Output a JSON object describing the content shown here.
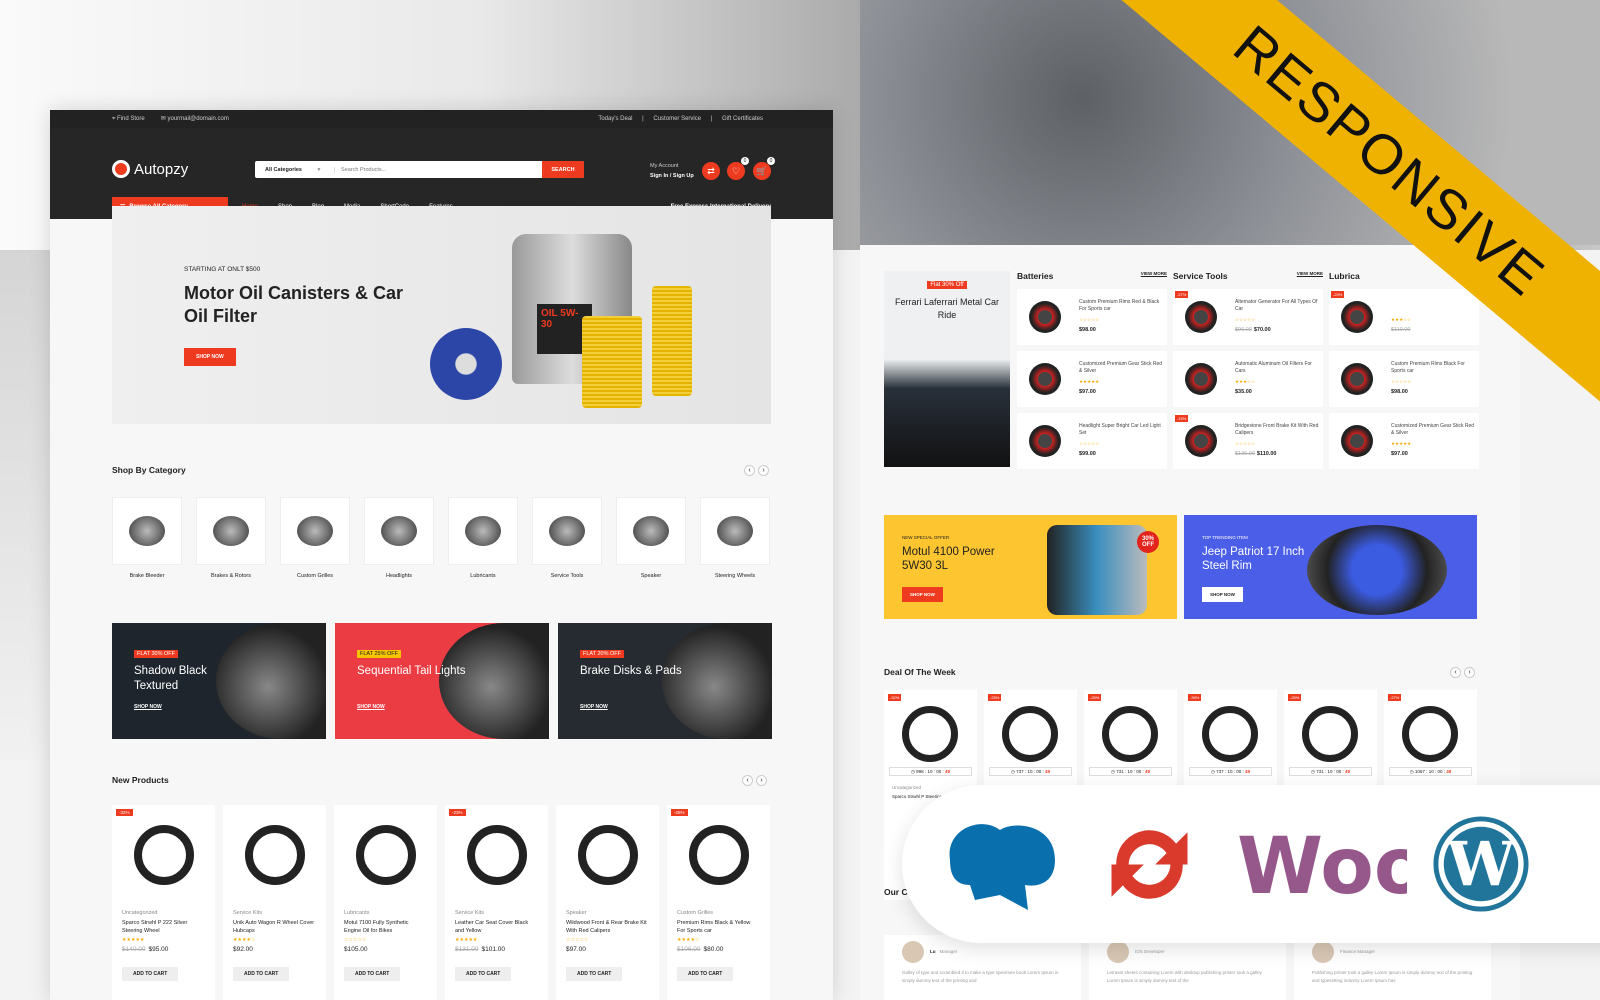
{
  "topbar": {
    "find_store": "Find Store",
    "email": "yourmail@domain.com",
    "links": [
      "Today's Deal",
      "Customer Service",
      "Gift Certificates"
    ]
  },
  "header": {
    "brand": "Autopzy",
    "category": "All Categories",
    "search_placeholder": "Search Products...",
    "search_button": "SEARCH",
    "account_label": "My Account",
    "sign_in": "Sign In / Sign Up",
    "wishlist_count": "0",
    "cart_count": "0"
  },
  "nav": {
    "browse": "Browse All Category",
    "items": [
      "Home",
      "Shop",
      "Blog",
      "Media",
      "ShortCode",
      "Features"
    ],
    "delivery": "Free Express International Delivery"
  },
  "hero": {
    "subtitle": "STARTING AT ONLT $500",
    "title": "Motor Oil Canisters & Car Oil Filter",
    "button": "SHOP NOW",
    "product_label": "OIL 5W-30"
  },
  "shop_by_category": {
    "title": "Shop By Category",
    "items": [
      "Brake Bleeder",
      "Brakes & Rotors",
      "Custom Grilles",
      "Headlights",
      "Lubricants",
      "Service Tools",
      "Speaker",
      "Steering Wheels"
    ]
  },
  "promos": [
    {
      "tag": "FLAT 30% OFF",
      "title": "Shadow Black Textured",
      "link": "SHOP NOW",
      "bg": "#1e252d",
      "tag_bg": "#ee3b1f"
    },
    {
      "tag": "FLAT 25% OFF",
      "title": "Sequential Tail Lights",
      "link": "SHOP NOW",
      "bg": "#ec3c43",
      "tag_bg": "#f5c400"
    },
    {
      "tag": "FLAT 20% OFF",
      "title": "Brake Disks & Pads",
      "link": "SHOP NOW",
      "bg": "#262b31",
      "tag_bg": "#ee3b1f"
    }
  ],
  "new_products": {
    "title": "New Products",
    "add_label": "ADD TO CART",
    "items": [
      {
        "badge": "-32%",
        "category": "Uncategorized",
        "name": "Sparco Strwhl P 222 Silver Steering Wheel",
        "rating": 5,
        "old": "$140.00",
        "price": "$95.00"
      },
      {
        "badge": "",
        "category": "Service Kits",
        "name": "Unik Auto Wagon R Wheel Cover Hubcaps",
        "rating": 4,
        "old": "",
        "price": "$92.00"
      },
      {
        "badge": "",
        "category": "Lubricants",
        "name": "Motul 7100 Fully Synthetic Engine Oil for Bikes",
        "rating": 0,
        "old": "",
        "price": "$105.00"
      },
      {
        "badge": "-23%",
        "category": "Service Kits",
        "name": "Leather Car Seat Cover Black and Yellow",
        "rating": 5,
        "old": "$131.00",
        "price": "$101.00"
      },
      {
        "badge": "",
        "category": "Speaker",
        "name": "Wildwood Front & Rear Brake Kit With Red Calipers",
        "rating": 0,
        "old": "",
        "price": "$97.00"
      },
      {
        "badge": "-25%",
        "category": "Custom Grilles",
        "name": "Premium Rims Black & Yellow For Sports car",
        "rating": 4,
        "old": "$106.00",
        "price": "$80.00"
      }
    ]
  },
  "featured": {
    "tag": "Flat 30% Off",
    "title": "Ferrari Laferrari Metal Car Ride"
  },
  "columns": [
    {
      "title": "Batteries",
      "view_more": "VIEW MORE",
      "items": [
        {
          "badge": "",
          "name": "Custom Premium Rims Red & Black For Sports car",
          "rating": 0,
          "old": "",
          "price": "$98.00"
        },
        {
          "badge": "",
          "name": "Customized Premium Gear Stick Red & Silver",
          "rating": 5,
          "old": "",
          "price": "$97.00"
        },
        {
          "badge": "",
          "name": "Headlight Super Bright Car Led Light Set",
          "rating": 0,
          "old": "",
          "price": "$99.00"
        }
      ]
    },
    {
      "title": "Service Tools",
      "view_more": "VIEW MORE",
      "items": [
        {
          "badge": "-27%",
          "name": "Alternator Generator For All Types Of Car",
          "rating": 0,
          "old": "$96.00",
          "price": "$70.00"
        },
        {
          "badge": "",
          "name": "Automatic Aluminum Oil Filters For Cars",
          "rating": 3,
          "old": "",
          "price": "$35.00"
        },
        {
          "badge": "-19%",
          "name": "Bridgestone Front Brake Kit With Red Calipers",
          "rating": 0,
          "old": "$136.00",
          "price": "$110.00"
        }
      ]
    },
    {
      "title": "Lubrica",
      "view_more": "",
      "items": [
        {
          "badge": "-23%",
          "name": "",
          "rating": 3,
          "old": "$110.00",
          "price": ""
        },
        {
          "badge": "",
          "name": "Custom Premium Rims Black For Sports car",
          "rating": 0,
          "old": "",
          "price": "$98.00"
        },
        {
          "badge": "",
          "name": "Customized Premium Gear Stick Red & Silver",
          "rating": 5,
          "old": "",
          "price": "$97.00"
        }
      ]
    }
  ],
  "banners": [
    {
      "sub": "NEW SPECIAL OFFER",
      "title": "Motul 4100 Power 5W30 3L",
      "button": "SHOP NOW",
      "offer": "30% OFF",
      "bg": "#fdc530"
    },
    {
      "sub": "TOP TRENDING ITEM",
      "title": "Jeep Patriot 17 Inch Steel Rim",
      "button": "SHOP NOW",
      "bg": "#4a5ee8"
    }
  ],
  "deal": {
    "title": "Deal Of The Week",
    "items": [
      {
        "badge": "-32%",
        "timer": [
          "998",
          "10",
          "00",
          "49"
        ],
        "category": "Uncategorized",
        "name": "Sparco Strwhl P Steering Wh"
      },
      {
        "badge": "-23%",
        "timer": [
          "737",
          "10",
          "00",
          "49"
        ]
      },
      {
        "badge": "-25%",
        "timer": [
          "731",
          "10",
          "00",
          "49"
        ]
      },
      {
        "badge": "-39%",
        "timer": [
          "737",
          "10",
          "00",
          "49"
        ]
      },
      {
        "badge": "-25%",
        "timer": [
          "731",
          "10",
          "00",
          "49"
        ]
      },
      {
        "badge": "-27%",
        "timer": [
          "1067",
          "10",
          "00",
          "49"
        ]
      }
    ]
  },
  "testimonials": {
    "title": "Our C",
    "items": [
      {
        "name": "Lu",
        "role": "Manager",
        "text": "Galley of type and scrambled it to make a type specimen book Lorem Ipsum is simply dummy text of the printing and"
      },
      {
        "name": "",
        "role": "IOS Developer",
        "text": "Letraset sheets containing Lorem with desktop publishing printer took a galley Lorem Ipsum is simply dummy text of the"
      },
      {
        "name": "",
        "role": "Finance Manager",
        "text": "Publishing printer took a galley Lorem Ipsum is simply dummy text of the printing and typesetting industry Lorem Ipsum has"
      }
    ]
  },
  "ribbon": {
    "text": "RESPONSIVE",
    "color": "#f0b200"
  },
  "logos": [
    "chef-hat-logo",
    "sync-icon",
    "woo-logo",
    "wordpress-logo"
  ],
  "colors": {
    "accent": "#ee3b1f",
    "dark": "#262626",
    "star": "#f6a800"
  }
}
